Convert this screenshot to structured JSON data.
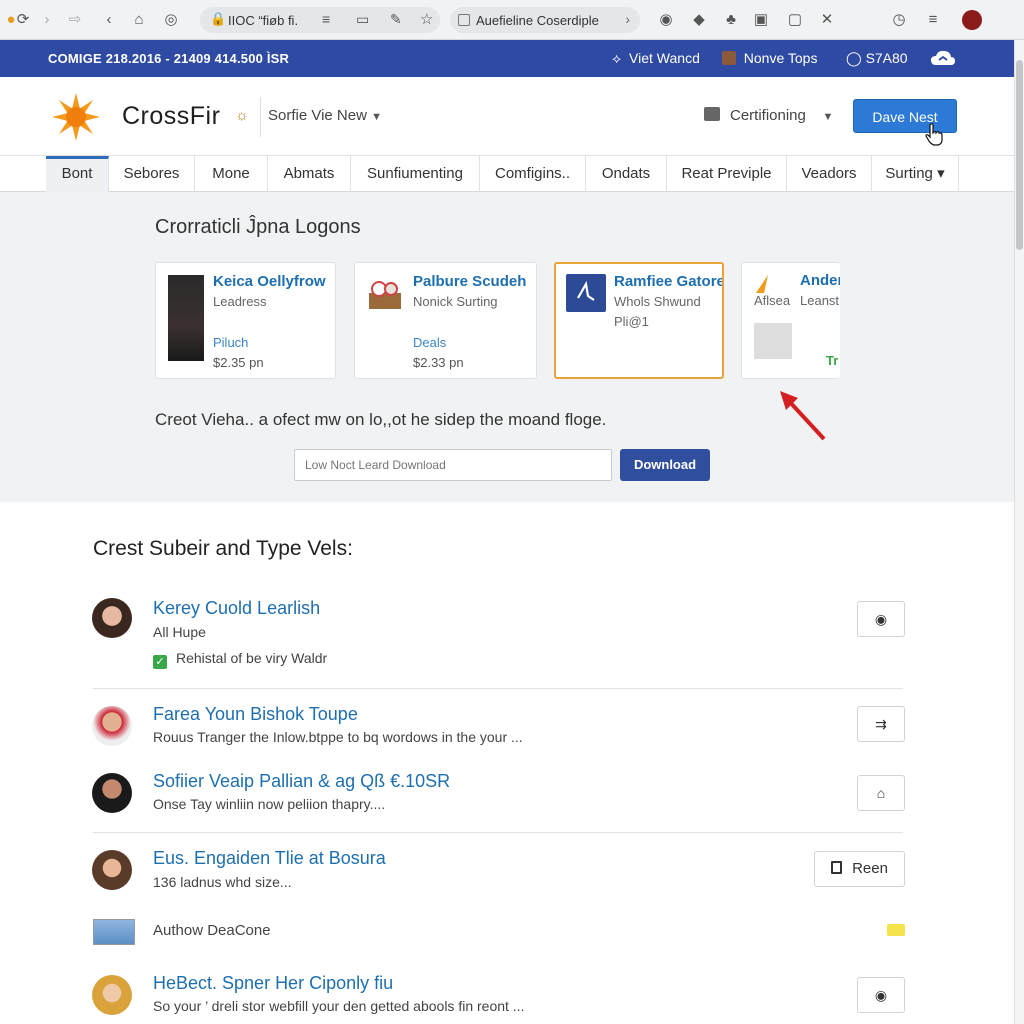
{
  "browser": {
    "url": "IIOC “fiøb fi.",
    "tab_title": "Auefieline Coserdiple"
  },
  "topbar": {
    "left_text": "COMIGE 218.2016 - 21409 414.500 ÌSR",
    "item1": "Viet Wancd",
    "item2": "Nonve Tops",
    "item3": "S7A80"
  },
  "header": {
    "brand": "CrossFir",
    "site_select": "Sorfie Vie New",
    "cert_label": "Certifioning",
    "cta_label": "Dave Nest"
  },
  "nav": {
    "tabs": [
      "Bont",
      "Sebores",
      "Mone",
      "Abmats",
      "Sunfiumenting",
      "Comfigins..",
      "Ondats",
      "Reat Previple",
      "Veadors",
      "Surting ▾"
    ]
  },
  "promo": {
    "title": "Crorraticli Ĵpna Logons",
    "cards": [
      {
        "name": "Keica Oellyfrow",
        "sub": "Leadress",
        "link": "Piluch",
        "price": "$2.35 pn"
      },
      {
        "name": "Palbure Scudeh",
        "sub": "Nonick Surting",
        "link": "Deals",
        "price": "$2.33 pn"
      },
      {
        "name": "Ramfiee Gatore",
        "sub": "Whols Shwund",
        "extra": "Pli@1"
      },
      {
        "name": "Ander",
        "sub": "Leanst",
        "extra": "Tr"
      }
    ],
    "text": "Creot Vieha.. a ofect mw on lo,,ot he sidep the moand floge.",
    "input_placeholder": "Low Noct Leard Download",
    "download_label": "Download"
  },
  "list": {
    "title": "Crest Subeir and Type Vels:",
    "items": [
      {
        "title": "Kerey Cuold Learlish",
        "sub": "All Hupe",
        "note": "Rehistal of be viry Waldr",
        "btn": "◉"
      },
      {
        "title": "Farea Youn Bishok Toupe",
        "sub": "Rouus Tranger the Inlow.btppe to bq wordows in the your ...",
        "btn": "⇉"
      },
      {
        "title": "Sofiier Veaip Pallian & ag Qß €.10SR",
        "sub": "Onse Tay winliin now peliion thapry....",
        "btn": "⌂"
      },
      {
        "title": "Eus. Engaiden Tlie at Bosura",
        "sub": "136 ladnus whd size...",
        "btn": "Reen"
      },
      {
        "title": "Authow DeaCone"
      },
      {
        "title": "HeBect. Spner Her Ciponly fiu",
        "sub": "So your ’ dreli stor webfill your den getted abools fin reont ...",
        "btn": "◉"
      }
    ]
  },
  "colors": {
    "topbar": "#2e4aa3",
    "accent_blue": "#2c7ad6",
    "link_blue": "#1e6fb0",
    "selected_border": "#e8a33a",
    "arrow_red": "#d42020"
  }
}
